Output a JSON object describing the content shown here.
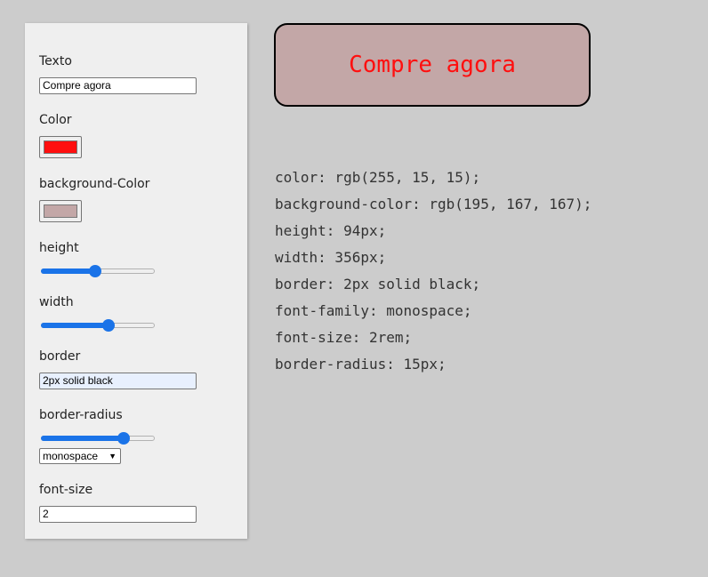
{
  "controls": {
    "texto": {
      "label": "Texto",
      "value": "Compre agora"
    },
    "color": {
      "label": "Color",
      "value": "#ff0f0f"
    },
    "background_color": {
      "label": "background-Color",
      "value": "#c3a7a7"
    },
    "height": {
      "label": "height",
      "value": 0.48
    },
    "width": {
      "label": "width",
      "value": 0.59
    },
    "border": {
      "label": "border",
      "value": "2px solid black"
    },
    "border_radius": {
      "label": "border-radius",
      "value": 0.73
    },
    "font_family": {
      "selected": "monospace"
    },
    "font_size": {
      "label": "font-size",
      "value": "2"
    }
  },
  "preview": {
    "text": "Compre agora",
    "text_color": "#ff0f0f",
    "background": "#c3a7a7"
  },
  "css_output": [
    "color: rgb(255, 15, 15);",
    "background-color: rgb(195, 167, 167);",
    "height: 94px;",
    "width: 356px;",
    "border: 2px solid black;",
    "font-family: monospace;",
    "font-size: 2rem;",
    "border-radius: 15px;"
  ]
}
